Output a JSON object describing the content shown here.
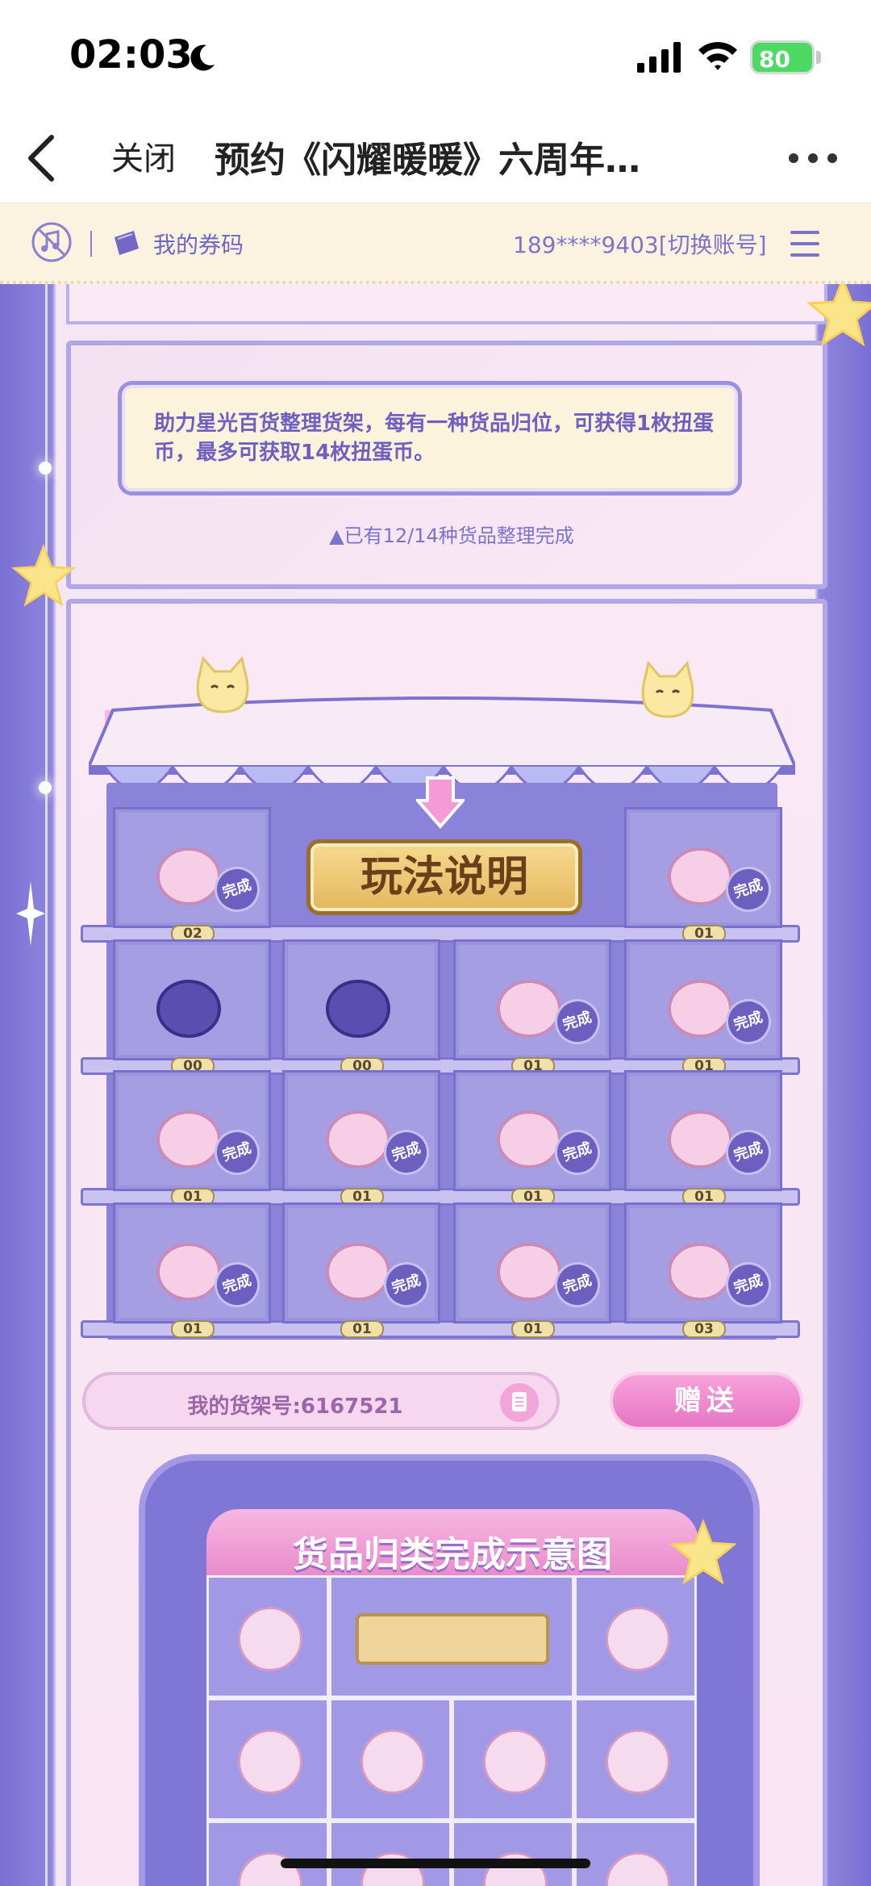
{
  "status_bar": {
    "time": "02:03",
    "battery": "80"
  },
  "nav": {
    "back_label": "",
    "close_label": "关闭",
    "title": "预约《闪耀暖暖》六周年…"
  },
  "header": {
    "my_code_label": "我的券码",
    "account": "189****9403[切换账号]"
  },
  "info": {
    "description": "助力星光百货整理货架，每有一种货品归位，可获得1枚扭蛋币，最多可获取14枚扭蛋币。",
    "progress": "▲已有12/14种货品整理完成"
  },
  "shelf": {
    "guide_label": "玩法说明",
    "done_label": "完成",
    "rows": [
      [
        {
          "icon": "backpack-icon",
          "count": "02",
          "done": true
        },
        {
          "icon": "guide-sign",
          "count": "",
          "done": false
        },
        {
          "icon": "photo-album-icon",
          "count": "01",
          "done": true
        }
      ],
      [
        {
          "icon": "flower-basket-icon",
          "count": "00",
          "done": false
        },
        {
          "icon": "perfume-bottle-icon",
          "count": "00",
          "done": false
        },
        {
          "icon": "seashell-ring-icon",
          "count": "01",
          "done": true
        },
        {
          "icon": "bunny-mug-icon",
          "count": "01",
          "done": true
        }
      ],
      [
        {
          "icon": "bunny-hat-icon",
          "count": "01",
          "done": true
        },
        {
          "icon": "suitcase-icon",
          "count": "01",
          "done": true
        },
        {
          "icon": "crystal-ball-icon",
          "count": "01",
          "done": true
        },
        {
          "icon": "milk-carton-icon",
          "count": "01",
          "done": true
        }
      ],
      [
        {
          "icon": "moon-pillow-icon",
          "count": "01",
          "done": true
        },
        {
          "icon": "eyeshadow-palette-icon",
          "count": "01",
          "done": true
        },
        {
          "icon": "cake-slice-icon",
          "count": "01",
          "done": true
        },
        {
          "icon": "camera-icon",
          "count": "03",
          "done": true
        }
      ]
    ]
  },
  "bottom": {
    "shelf_id": "我的货架号:6167521",
    "gift_label": "赠送"
  },
  "diagram": {
    "title": "货品归类完成示意图"
  },
  "colors": {
    "primary": "#8076d6",
    "pink": "#e98ccc",
    "cream": "#fbf3dc"
  }
}
